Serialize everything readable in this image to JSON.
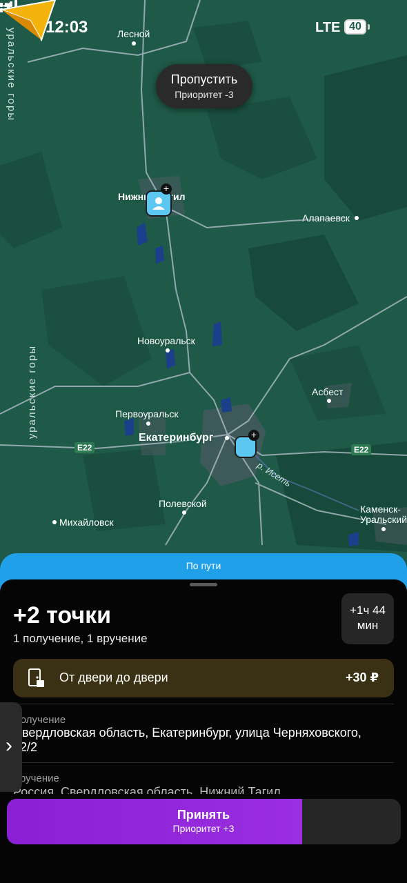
{
  "status_bar": {
    "time": "12:03",
    "network": "LTE",
    "battery": "40"
  },
  "map": {
    "skip_button": {
      "title": "Пропустить",
      "subtitle": "Приоритет -3"
    },
    "cities": {
      "lesnoy": "Лесной",
      "nizhny_tagil": "Нижний Тагил",
      "alapaevsk": "Алапаевск",
      "novouralsk": "Новоуральск",
      "asbest": "Асбест",
      "pervouralsk": "Первоуральск",
      "ekaterinburg": "Екатеринбург",
      "polevskoy": "Полевской",
      "mikhaylovsk": "Михайловск",
      "kamensk_1": "Каменск-",
      "kamensk_2": "Уральский"
    },
    "roads": {
      "e22_left": "E22",
      "e22_right": "E22"
    },
    "river": "р. Исеть",
    "mountain_label_1": "уральские горы",
    "mountain_label_2": "уральские горы",
    "colors": {
      "land": "#1f5a48",
      "forest": "#174a3b",
      "water": "#1b3f8a",
      "route": "#b8c4d0"
    }
  },
  "sheet": {
    "banner": "По пути",
    "title": "+2 точки",
    "subtitle": "1 получение, 1 вручение",
    "eta_line1": "+1ч 44",
    "eta_line2": "мин",
    "door_service": {
      "label": "От двери до двери",
      "price": "+30 ₽"
    },
    "stops": [
      {
        "caption": "Получение",
        "address": "Свердловская область, Екатеринбург, улица Черняховского, 32/2"
      },
      {
        "caption": "Вручение",
        "address": "Россия, Свердловская область, Нижний Тагил"
      }
    ],
    "accept_button": {
      "title": "Принять",
      "subtitle": "Приоритет +3",
      "progress": 0.75
    },
    "colors": {
      "accept": "#8a1fd4",
      "banner": "#1fa0e9",
      "door_bg": "#3a3013"
    }
  }
}
